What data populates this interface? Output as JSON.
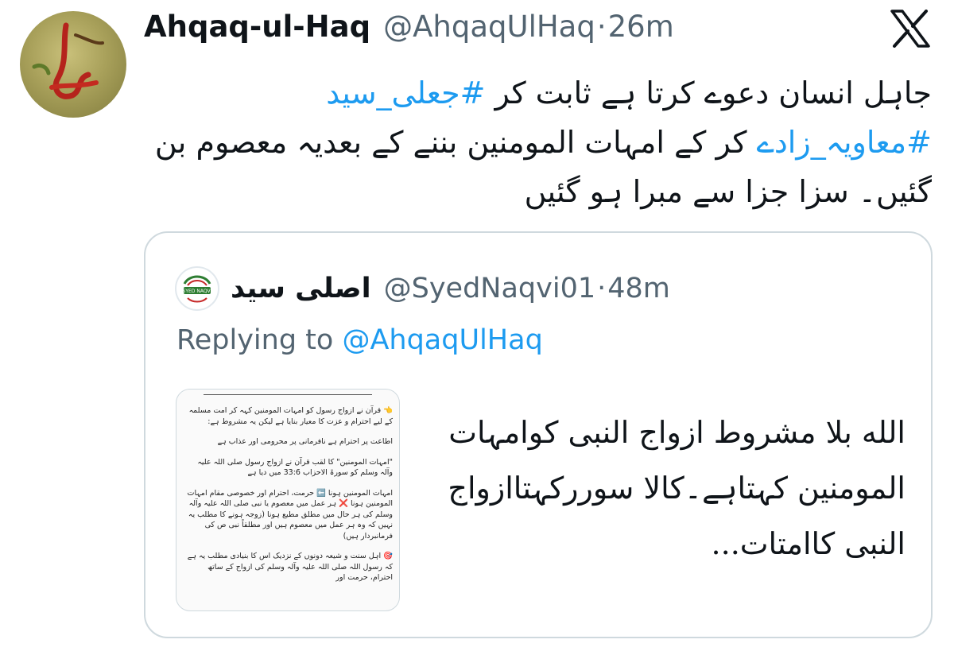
{
  "tweet": {
    "author_name": "Ahqaq-ul-Haq",
    "author_handle": "@AhqaqUlHaq",
    "separator": "·",
    "time": "26m",
    "logo_icon": "x-logo-icon",
    "text_part1": "جاہل انسان دعوے کرتا ہے ثابت کر ",
    "hashtag1": "#جعلی_سید",
    "text_part2": " ",
    "hashtag2": "#معاویہ_زادے",
    "text_part3": " کر کے امہات المومنین بننے کے بعدیہ معصوم بن گئیں۔ سزا جزا سے مبرا ہو گئیں"
  },
  "quote": {
    "author_name": "اصلی سید",
    "author_handle": "@SyedNaqvi01",
    "separator": "·",
    "time": "48m",
    "avatar_text": "SYED NAQVI",
    "replying_prefix": "Replying to ",
    "replying_handle": "@AhqaqUlHaq",
    "text": "الله بلا مشروط ازواج النبی کوامہات المومنین کہتاہے۔کالا سوررکہتاازواج النبی کاامتات...",
    "media": {
      "para1": "👈 قرآن نے ازواج رسول کو امہات المومنین کہہ کر امت مسلمہ کے لیے احترام و عزت کا معیار بنایا ہے لیکن یہ مشروط ہے:",
      "para2": "اطاعت پر احترام ہے نافرمانی پر محرومی اور عذاب ہے",
      "para3": "\"امہات المومنین\" کا لقب قرآن نے ازواج رسول صلی اللہ علیہ وآلہ وسلم کو سورۃ الاحزاب 33:6 میں دیا ہے",
      "para4": "امہات المومنین ہونا ⬅️ حرمت، احترام اور خصوصی مقام امہات المومنین ہونا ❌ ہر عمل میں معصوم یا نبی صلی اللہ علیہ وآلہ وسلم کی ہر حال میں مطلق مطیع ہونا (زوجہ ہونے کا مطلب یہ نہیں کہ وہ ہر عمل میں معصوم ہیں اور مطلقاً نبی ص کی فرمانبردار ہیں)",
      "para5": "🎯 اہل سنت و شیعہ دونوں کے نزدیک اس کا بنیادی مطلب یہ ہے کہ رسول اللہ صلی اللہ علیہ وآلہ وسلم کی ازواج کے ساتھ احترام، حرمت اور"
    }
  }
}
